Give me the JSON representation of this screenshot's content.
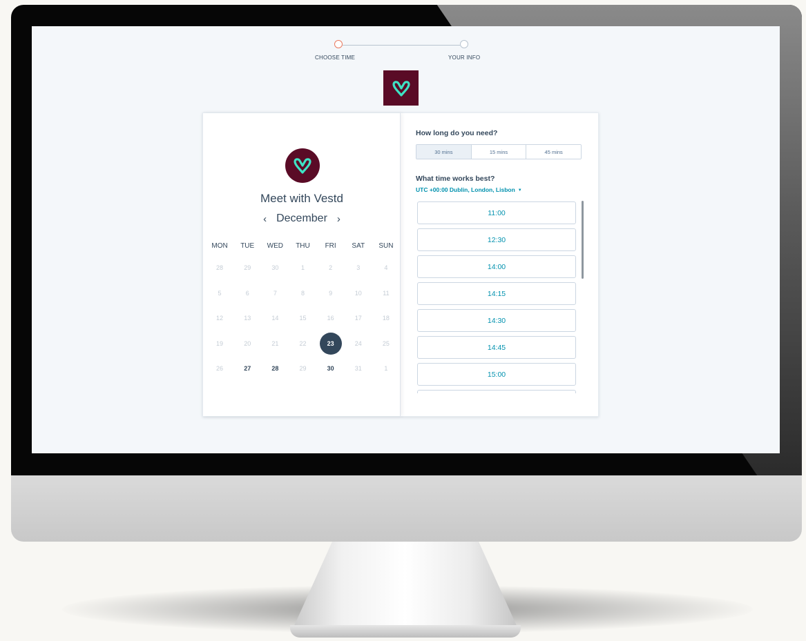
{
  "steps": [
    {
      "label": "CHOOSE TIME",
      "state": "active"
    },
    {
      "label": "YOUR INFO",
      "state": "inactive"
    }
  ],
  "brand": {
    "logo_icon": "vestd-logo-icon",
    "primary_color": "#5a0b26",
    "accent_color": "#3ee3c4"
  },
  "meeting": {
    "title": "Meet with Vestd"
  },
  "calendar": {
    "month": "December",
    "prev_icon": "chevron-left-icon",
    "next_icon": "chevron-right-icon",
    "prev_glyph": "‹",
    "next_glyph": "›",
    "weekdays": [
      "MON",
      "TUE",
      "WED",
      "THU",
      "FRI",
      "SAT",
      "SUN"
    ],
    "weeks": [
      [
        "28",
        "29",
        "30",
        "1",
        "2",
        "3",
        "4"
      ],
      [
        "5",
        "6",
        "7",
        "8",
        "9",
        "10",
        "11"
      ],
      [
        "12",
        "13",
        "14",
        "15",
        "16",
        "17",
        "18"
      ],
      [
        "19",
        "20",
        "21",
        "22",
        "23",
        "24",
        "25"
      ],
      [
        "26",
        "27",
        "28",
        "29",
        "30",
        "31",
        "1"
      ]
    ],
    "available_days": [
      "23",
      "27",
      "28",
      "30"
    ],
    "selected_day": "23"
  },
  "duration": {
    "question": "How long do you need?",
    "options": [
      "30 mins",
      "15 mins",
      "45 mins"
    ],
    "selected": "30 mins"
  },
  "time": {
    "question": "What time works best?",
    "timezone": "UTC +00:00 Dublin, London, Lisbon",
    "timezone_icon": "caret-down-icon",
    "slots": [
      "11:00",
      "12:30",
      "14:00",
      "14:15",
      "14:30",
      "14:45",
      "15:00",
      ""
    ]
  }
}
